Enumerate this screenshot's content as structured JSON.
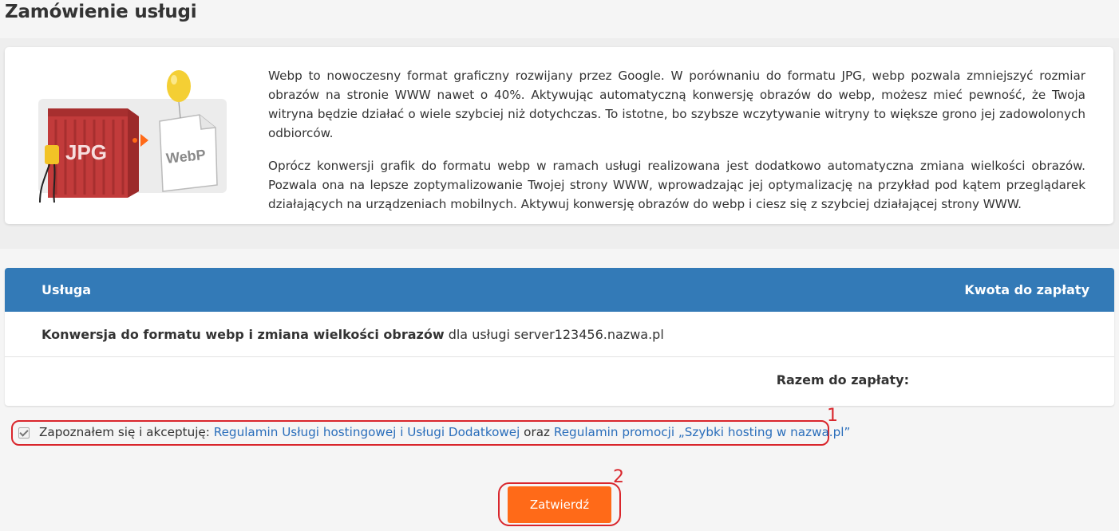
{
  "page": {
    "title": "Zamówienie usługi"
  },
  "info": {
    "illustration": {
      "jpg_label": "JPG",
      "webp_label": "WebP"
    },
    "paragraphs": [
      "Webp to nowoczesny format graficzny rozwijany przez Google. W porównaniu do formatu JPG, webp pozwala zmniejszyć rozmiar obrazów na stronie WWW nawet o 40%. Aktywując automatyczną konwersję obrazów do webp, możesz mieć pewność, że Twoja witryna będzie działać o wiele szybciej niż dotychczas. To istotne, bo szybsze wczytywanie witryny to większe grono jej zadowolonych odbiorców.",
      "Oprócz konwersji grafik do formatu webp w ramach usługi realizowana jest dodatkowo automatyczna zmiana wielkości obrazów. Pozwala ona na lepsze zoptymalizowanie Twojej strony WWW, wprowadzając jej optymalizację na przykład pod kątem przeglądarek działających na urządzeniach mobilnych. Aktywuj konwersję obrazów do webp i ciesz się z szybciej działającej strony WWW."
    ]
  },
  "table": {
    "col_service": "Usługa",
    "col_amount": "Kwota do zapłaty",
    "row": {
      "service_name": "Konwersja do formatu webp i zmiana wielkości obrazów",
      "service_suffix": " dla usługi server123456.nazwa.pl"
    },
    "total_label": "Razem do zapłaty:"
  },
  "terms": {
    "checked": true,
    "prefix": "Zapoznałem się i akceptuję: ",
    "link1": "Regulamin Usługi hostingowej i Usługi Dodatkowej",
    "middle": " oraz ",
    "link2": "Regulamin promocji „Szybki hosting w nazwa.pl”"
  },
  "annotations": {
    "marker1": "1",
    "marker2": "2"
  },
  "submit": {
    "label": "Zatwierdź"
  },
  "colors": {
    "accent": "#337ab7",
    "button": "#ff6a18",
    "highlight": "#d9262c",
    "link": "#2a6ebb"
  }
}
